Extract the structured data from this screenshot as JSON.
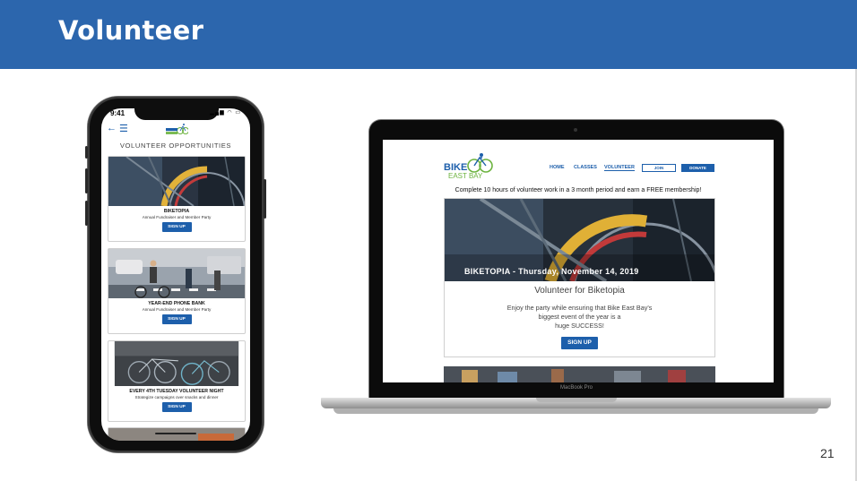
{
  "slide": {
    "title": "Volunteer",
    "page_number": "21"
  },
  "phone": {
    "status_time": "9:41",
    "status_icons": "▂▄▆ ◠ ▭",
    "logo_text": "BIKE EAST BAY",
    "heading": "VOLUNTEER OPPORTUNITIES",
    "cards": [
      {
        "title": "BIKETOPIA",
        "subtitle": "Annual Fundraiser and Member Party",
        "button": "SIGN UP"
      },
      {
        "title": "YEAR-END PHONE BANK",
        "subtitle": "Annual Fundraiser and Member Party",
        "button": "SIGN UP"
      },
      {
        "title": "EVERY 4TH TUESDAY VOLUNTEER NIGHT",
        "subtitle": "Strategize campaigns over snacks and dinner",
        "button": "SIGN UP"
      }
    ]
  },
  "laptop": {
    "brand": "MacBook Pro",
    "logo_line1": "BIKE",
    "logo_line2": "EAST BAY",
    "nav": {
      "home": "HOME",
      "classes": "CLASSES",
      "volunteer": "VOLUNTEER",
      "join": "JOIN",
      "donate": "DONATE"
    },
    "tagline": "Complete 10 hours of volunteer work in a 3 month period and earn a FREE membership!",
    "event": {
      "caption": "BIKETOPIA - Thursday, November 14, 2019",
      "title": "Volunteer for Biketopia",
      "body_line1": "Enjoy the party while ensuring that Bike East Bay's",
      "body_line2": "biggest event of the year is a",
      "body_line3": "huge SUCCESS!",
      "button": "SIGN UP"
    }
  },
  "colors": {
    "header": "#2c66ad",
    "brand_blue": "#1d5fab",
    "brand_green": "#6cb33f"
  }
}
